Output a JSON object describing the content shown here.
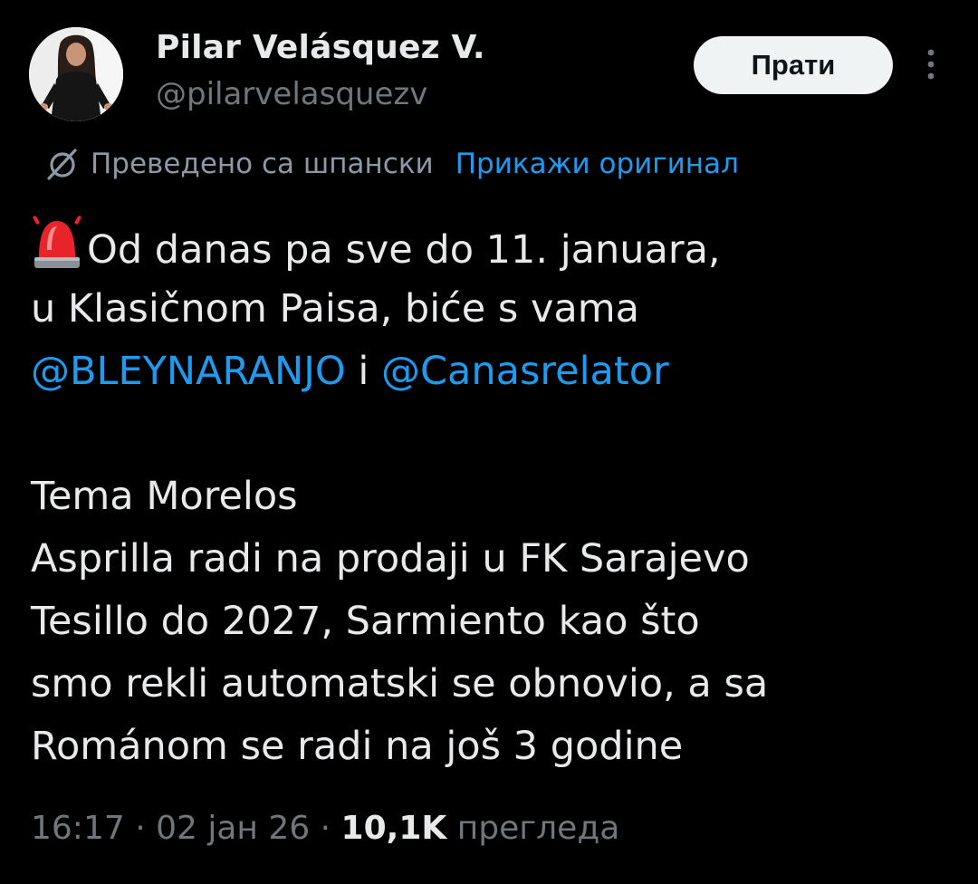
{
  "author": {
    "display_name": "Pilar Velásquez V.",
    "handle": "@pilarvelasquezv",
    "avatar_icon": "profile-photo"
  },
  "actions": {
    "follow_label": "Прати",
    "more_icon": "vertical-ellipsis-icon"
  },
  "translation": {
    "icon": "translate-icon",
    "note": "Преведено са шпански",
    "show_original": "Прикажи оригинал"
  },
  "tweet": {
    "emoji": "police-siren-light",
    "line1": "Od danas pa sve do 11. januara,",
    "line2": "u Klasičnom Paisa, biće s vama",
    "mention1": "@BLEYNARANJO",
    "connector": " i ",
    "mention2": "@Canasrelator",
    "line4": "Tema Morelos",
    "line5": "Asprilla radi na prodaji u FK Sarajevo",
    "line6": "Tesillo do 2027, Sarmiento kao što",
    "line7": "smo rekli automatski se obnovio, a sa",
    "line8": "Románom se radi na još 3 godine"
  },
  "meta": {
    "time": "16:17",
    "separator": " · ",
    "date": "02 јан 26",
    "views_count": "10,1K",
    "views_label": " прегледа"
  },
  "colors": {
    "background": "#000000",
    "text_primary": "#e7e9ea",
    "text_secondary": "#71767b",
    "link": "#1d9bf0",
    "follow_bg": "#eff3f4"
  }
}
